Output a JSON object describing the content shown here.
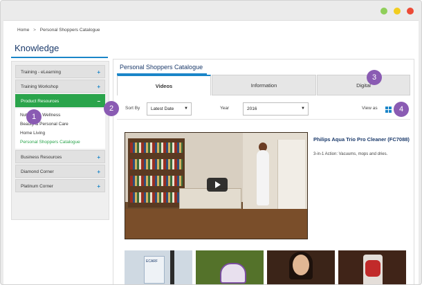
{
  "window": {
    "controls": [
      "minimize-dot",
      "maximize-dot",
      "close-dot"
    ],
    "colors": {
      "green": "#8fcf5a",
      "yellow": "#f2cd1f",
      "red": "#ec4a36"
    }
  },
  "breadcrumb": {
    "home": "Home",
    "separator": ">",
    "current": "Personal Shoppers Catalogue"
  },
  "page_title": "Knowledge",
  "sidebar": {
    "items": [
      {
        "label": "Training - eLearning",
        "toggle": "+"
      },
      {
        "label": "Training Workshop",
        "toggle": "+"
      },
      {
        "label": "Product Resources",
        "toggle": "−"
      },
      {
        "label": "Business Resources",
        "toggle": "+"
      },
      {
        "label": "Diamond Corner",
        "toggle": "+"
      },
      {
        "label": "Platinum Corner",
        "toggle": "+"
      }
    ],
    "sub_items": [
      "Nutrition & Wellness",
      "Beauty & Personal Care",
      "Home Living",
      "Personal Shoppers Catalogue"
    ],
    "active_color": "#2aa44b"
  },
  "panel": {
    "title": "Personal Shoppers Catalogue",
    "tabs": [
      "Videos",
      "Information",
      "Digital"
    ],
    "sort_label": "Sort By",
    "sort_value": "Latest Date",
    "year_label": "Year",
    "year_value": "2016",
    "view_label": "View as",
    "view_icon": "grid-view-icon"
  },
  "featured": {
    "title": "Philips Aqua Trio Pro Cleaner (FC7088)",
    "description": "3-in-1 Action: Vacuums, mops and dries."
  },
  "thumbnails": {
    "t1_text": "ECARF",
    "count": 4
  },
  "callouts": [
    "1",
    "2",
    "3",
    "4"
  ],
  "accent_color": "#1a85c8",
  "callout_color": "#8a5bb3"
}
